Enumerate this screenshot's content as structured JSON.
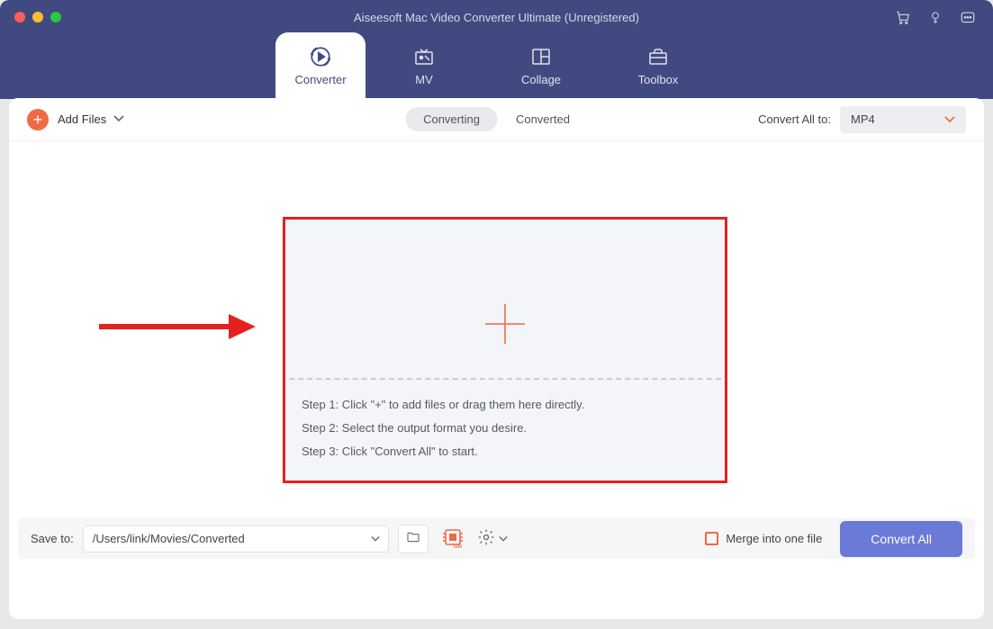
{
  "app_title": "Aiseesoft Mac Video Converter Ultimate (Unregistered)",
  "tabs": [
    {
      "label": "Converter"
    },
    {
      "label": "MV"
    },
    {
      "label": "Collage"
    },
    {
      "label": "Toolbox"
    }
  ],
  "toolbar": {
    "add_files_label": "Add Files",
    "sub_tabs": {
      "converting": "Converting",
      "converted": "Converted"
    },
    "convert_all_to_label": "Convert All to:",
    "format_selected": "MP4"
  },
  "dropzone": {
    "step1": "Step 1: Click \"+\" to add files or drag them here directly.",
    "step2": "Step 2: Select the output format you desire.",
    "step3": "Step 3: Click \"Convert All\" to start."
  },
  "footer": {
    "save_to_label": "Save to:",
    "path": "/Users/link/Movies/Converted",
    "merge_label": "Merge into one file",
    "convert_all_button": "Convert All"
  },
  "colors": {
    "header_bg": "#414a80",
    "accent_orange": "#ef6a45",
    "accent_blue": "#6b7ad6",
    "annotation_red": "#e62020"
  }
}
